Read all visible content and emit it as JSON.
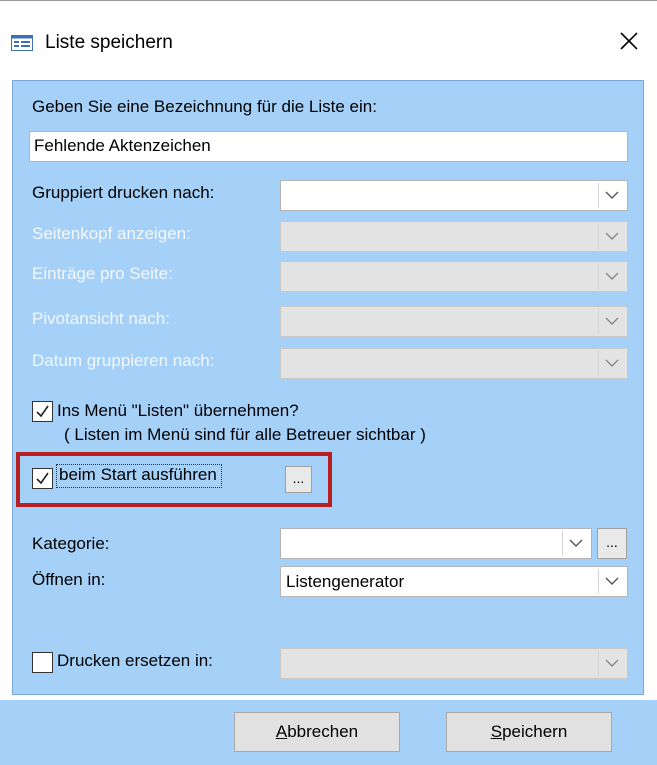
{
  "window": {
    "title": "Liste speichern"
  },
  "form": {
    "name_label": "Geben Sie eine Bezeichnung für die Liste ein:",
    "name_value": "Fehlende Aktenzeichen",
    "group_print_label": "Gruppiert drucken nach:",
    "group_print_value": "",
    "header_label": "Seitenkopf anzeigen:",
    "entries_label": "Einträge pro Seite:",
    "pivot_label": "Pivotansicht nach:",
    "date_group_label": "Datum gruppieren nach:",
    "menu_checkbox_checked": true,
    "menu_checkbox_label": "Ins Menü \"Listen\" übernehmen?",
    "menu_checkbox_note": "( Listen im Menü sind für alle Betreuer sichtbar )",
    "start_checkbox_checked": true,
    "start_checkbox_label": "beim Start ausführen",
    "ellipsis_label": "...",
    "category_label": "Kategorie:",
    "category_value": "",
    "open_in_label": "Öffnen in:",
    "open_in_value": "Listengenerator",
    "print_replace_checked": false,
    "print_replace_label": "Drucken ersetzen in:"
  },
  "buttons": {
    "cancel_rest": "bbrechen",
    "cancel_mnemonic": "A",
    "save_rest": "peichern",
    "save_mnemonic": "S"
  },
  "colors": {
    "panel_bg": "#a5d0f8",
    "highlight": "#b81f23"
  }
}
